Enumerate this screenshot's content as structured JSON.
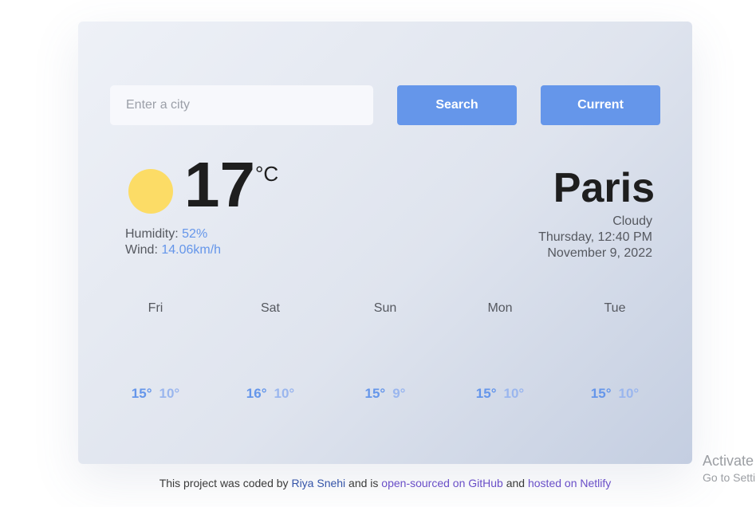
{
  "search": {
    "placeholder": "Enter a city",
    "search_label": "Search",
    "current_label": "Current"
  },
  "current": {
    "temperature": "17",
    "unit": "°C",
    "humidity_label": "Humidity:",
    "humidity_value": "52%",
    "wind_label": "Wind:",
    "wind_value": "14.06km/h",
    "icon": "sun-icon",
    "icon_color": "#fcdc66"
  },
  "location": {
    "city": "Paris",
    "description": "Cloudy",
    "day_time": "Thursday, 12:40 PM",
    "date": "November 9, 2022"
  },
  "forecast": [
    {
      "day": "Fri",
      "max": "15°",
      "min": "10°"
    },
    {
      "day": "Sat",
      "max": "16°",
      "min": "10°"
    },
    {
      "day": "Sun",
      "max": "15°",
      "min": "9°"
    },
    {
      "day": "Mon",
      "max": "15°",
      "min": "10°"
    },
    {
      "day": "Tue",
      "max": "15°",
      "min": "10°"
    }
  ],
  "footer": {
    "text_1": "This project was coded by ",
    "author": "Riya Snehi",
    "text_2": " and is ",
    "github": "open-sourced on GitHub",
    "text_3": " and ",
    "netlify": "hosted on Netlify"
  },
  "watermark": {
    "title": "Activate Windows",
    "subtitle": "Go to Settings to activate Windows."
  },
  "colors": {
    "accent": "#6596ea",
    "text_dark": "#1e1e1e",
    "text_muted": "#55585f"
  }
}
